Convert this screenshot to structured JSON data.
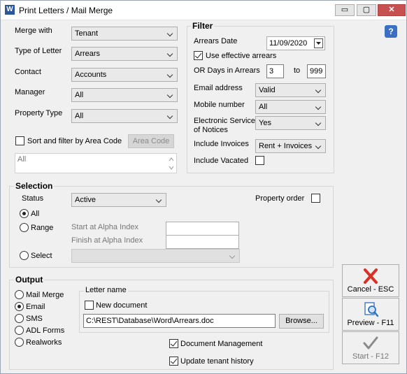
{
  "window": {
    "title": "Print Letters / Mail Merge",
    "app_icon_letter": "W",
    "minimize": "▭",
    "maximize": "▢",
    "close": "✕"
  },
  "help_icon": "?",
  "left": {
    "merge_with": {
      "label": "Merge with",
      "value": "Tenant"
    },
    "type_of_letter": {
      "label": "Type of Letter",
      "value": "Arrears"
    },
    "contact": {
      "label": "Contact",
      "value": "Accounts"
    },
    "manager": {
      "label": "Manager",
      "value": "All"
    },
    "property_type": {
      "label": "Property Type",
      "value": "All"
    },
    "sort_filter_area": {
      "label": "Sort and filter by Area Code",
      "checked": false
    },
    "area_code_button": "Area Code",
    "area_memo": "All"
  },
  "filter": {
    "title": "Filter",
    "arrears_date": {
      "label": "Arrears Date",
      "value": "11/09/2020"
    },
    "use_effective_arrears": {
      "label": "Use effective arrears",
      "checked": true
    },
    "or_days": {
      "label": "OR Days in Arrears",
      "from": "3",
      "to_label": "to",
      "to": "999"
    },
    "email_address": {
      "label": "Email address",
      "value": "Valid"
    },
    "mobile_number": {
      "label": "Mobile number",
      "value": "All"
    },
    "electronic_service": {
      "label_line1": "Electronic Service",
      "label_line2": "of Notices",
      "value": "Yes"
    },
    "include_invoices": {
      "label": "Include Invoices",
      "value": "Rent + Invoices"
    },
    "include_vacated": {
      "label": "Include Vacated",
      "checked": false
    }
  },
  "selection": {
    "title": "Selection",
    "status": {
      "label": "Status",
      "value": "Active"
    },
    "property_order": {
      "label": "Property order",
      "checked": false
    },
    "all": {
      "label": "All",
      "selected": true
    },
    "range": {
      "label": "Range",
      "selected": false
    },
    "start_alpha": {
      "label": "Start at Alpha Index",
      "value": ""
    },
    "finish_alpha": {
      "label": "Finish at Alpha Index",
      "value": ""
    },
    "select": {
      "label": "Select",
      "selected": false,
      "value": ""
    }
  },
  "output": {
    "title": "Output",
    "options": [
      {
        "label": "Mail Merge",
        "selected": false
      },
      {
        "label": "Email",
        "selected": true
      },
      {
        "label": "SMS",
        "selected": false
      },
      {
        "label": "ADL Forms",
        "selected": false
      },
      {
        "label": "Realworks",
        "selected": false
      }
    ],
    "letter_name_label": "Letter name",
    "new_document": {
      "label": "New document",
      "checked": false
    },
    "path": "C:\\REST\\Database\\Word\\Arrears.doc",
    "browse": "Browse...",
    "document_management": {
      "label": "Document Management",
      "checked": true
    },
    "update_tenant_history": {
      "label": "Update tenant history",
      "checked": true
    }
  },
  "actions": {
    "cancel": "Cancel - ESC",
    "preview": "Preview - F11",
    "start": "Start - F12"
  },
  "colors": {
    "cancel_icon": "#d93025",
    "preview_icon": "#2f6fc1",
    "start_icon": "#8a8a8a"
  }
}
